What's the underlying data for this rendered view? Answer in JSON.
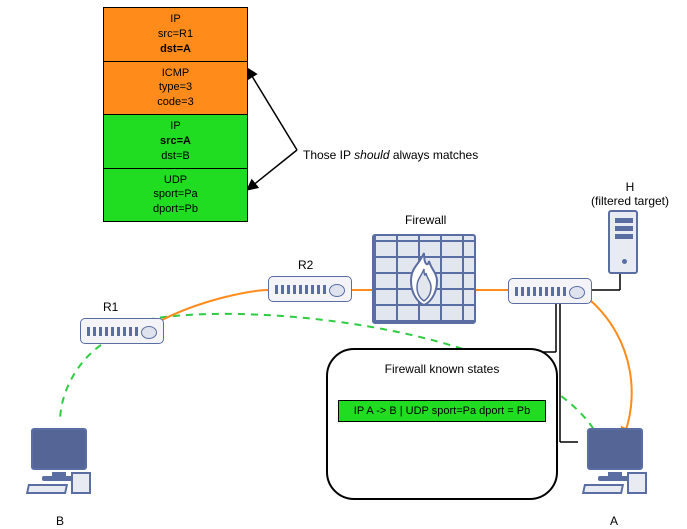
{
  "packet": {
    "ip_outer": {
      "l1": "IP",
      "l2": "src=R1",
      "l3": "dst=A"
    },
    "icmp": {
      "l1": "ICMP",
      "l2": "type=3",
      "l3": "code=3"
    },
    "ip_inner": {
      "l1": "IP",
      "l2": "src=A",
      "l3": "dst=B"
    },
    "udp": {
      "l1": "UDP",
      "l2": "sport=Pa",
      "l3": "dport=Pb"
    }
  },
  "annotation": {
    "pre": "Those IP ",
    "em": "should",
    "post": " always matches"
  },
  "labels": {
    "r1": "R1",
    "r2": "R2",
    "firewall": "Firewall",
    "h_l1": "H",
    "h_l2": "(filtered target)",
    "a": "A",
    "b": "B"
  },
  "statebox": {
    "title": "Firewall known states",
    "row": "IP A -> B | UDP sport=Pa dport = Pb"
  }
}
